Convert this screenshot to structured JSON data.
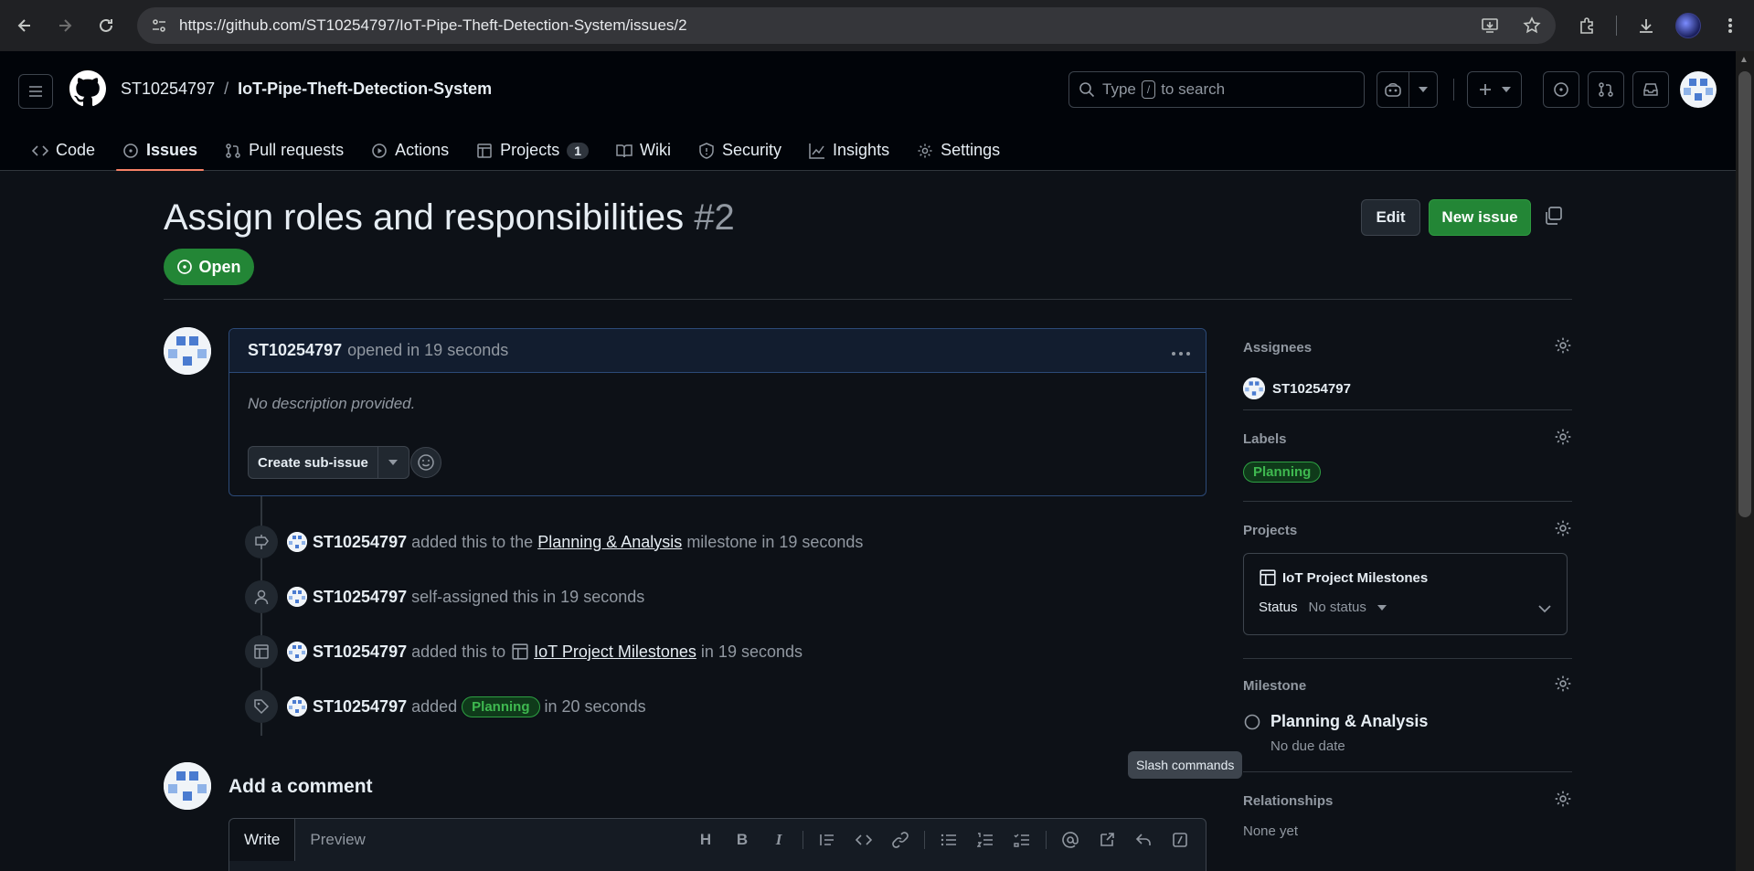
{
  "browser": {
    "url": "https://github.com/ST10254797/IoT-Pipe-Theft-Detection-System/issues/2"
  },
  "header": {
    "owner": "ST10254797",
    "separator": "/",
    "repo": "IoT-Pipe-Theft-Detection-System",
    "search_prefix": "Type",
    "search_key": "/",
    "search_suffix": "to search"
  },
  "tabs": [
    {
      "label": "Code",
      "icon": "code-icon"
    },
    {
      "label": "Issues",
      "icon": "issue-opened-icon",
      "active": true
    },
    {
      "label": "Pull requests",
      "icon": "git-pull-request-icon"
    },
    {
      "label": "Actions",
      "icon": "play-icon"
    },
    {
      "label": "Projects",
      "icon": "table-icon",
      "counter": "1"
    },
    {
      "label": "Wiki",
      "icon": "book-icon"
    },
    {
      "label": "Security",
      "icon": "shield-icon"
    },
    {
      "label": "Insights",
      "icon": "graph-icon"
    },
    {
      "label": "Settings",
      "icon": "gear-icon"
    }
  ],
  "issue": {
    "title": "Assign roles and responsibilities",
    "number": "#2",
    "edit_label": "Edit",
    "new_issue_label": "New issue",
    "state": "Open"
  },
  "comment": {
    "author": "ST10254797",
    "meta": "opened in 19 seconds",
    "body": "No description provided.",
    "create_subissue": "Create sub-issue"
  },
  "timeline": [
    {
      "icon": "milestone-icon",
      "author": "ST10254797",
      "pre": "added this to the",
      "link": "Planning & Analysis",
      "post": "milestone in 19 seconds"
    },
    {
      "icon": "person-icon",
      "author": "ST10254797",
      "pre": "self-assigned this in 19 seconds"
    },
    {
      "icon": "table-icon",
      "author": "ST10254797",
      "pre": "added this to",
      "link": "IoT Project Milestones",
      "post": "in 19 seconds"
    },
    {
      "icon": "tag-icon",
      "author": "ST10254797",
      "pre": "added",
      "label": "Planning",
      "post": "in 20 seconds"
    }
  ],
  "add_comment": {
    "title": "Add a comment",
    "tab_write": "Write",
    "tab_preview": "Preview",
    "tooltip": "Slash commands"
  },
  "sidebar": {
    "assignees_title": "Assignees",
    "assignee": "ST10254797",
    "labels_title": "Labels",
    "label": "Planning",
    "projects_title": "Projects",
    "project_name": "IoT Project Milestones",
    "status_key": "Status",
    "status_value": "No status",
    "milestone_title": "Milestone",
    "milestone_name": "Planning & Analysis",
    "milestone_due": "No due date",
    "relationships_title": "Relationships",
    "relationships_value": "None yet"
  },
  "colors": {
    "open_green": "#238636",
    "label_green": "#3fb950",
    "active_tab_underline": "#f78166"
  }
}
